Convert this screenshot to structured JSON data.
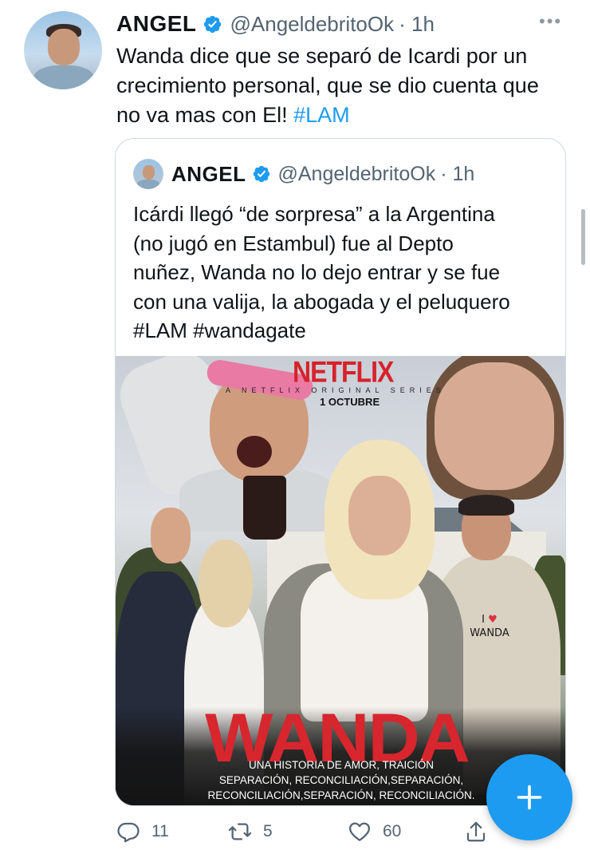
{
  "tweet": {
    "author_name": "ANGEL",
    "author_handle": "@AngeldebritoOk",
    "time": "· 1h",
    "more_icon": "more-horizontal-icon",
    "text_line1": "Wanda dice que se separó de Icardi por un",
    "text_line2": "crecimiento personal, que se dio cuenta que",
    "text_line3": "no va mas con El! ",
    "hashtag": "#LAM"
  },
  "quoted": {
    "author_name": "ANGEL",
    "author_handle": "@AngeldebritoOk",
    "time": "· 1h",
    "text_line1": "Icárdi llegó “de sorpresa” a la Argentina",
    "text_line2": "(no jugó en Estambul) fue al Depto",
    "text_line3": "nuñez, Wanda no lo dejo entrar y se fue",
    "text_line4": "con una valija, la abogada y el peluquero",
    "text_line5": "#LAM #wandagate",
    "poster": {
      "brand": "NETFLIX",
      "series_label": "A NETFLIX ORIGINAL SERIES",
      "date": "1 OCTUBRE",
      "title": "WANDA",
      "badge_line1": "I",
      "badge_line2": "WANDA",
      "tagline_line1": "UNA HISTORIA DE AMOR, TRAICIÓN",
      "tagline_line2": "SEPARACIÓN, RECONCILIACIÓN,SEPARACIÓN,",
      "tagline_line3": "RECONCILIACIÓN,SEPARACIÓN, RECONCILIACIÓN."
    }
  },
  "actions": {
    "replies": "11",
    "retweets": "5",
    "likes": "60"
  },
  "colors": {
    "accent": "#1d9bf0",
    "text": "#0f1419",
    "secondary": "#536471",
    "netflix_red": "#d6222b"
  }
}
